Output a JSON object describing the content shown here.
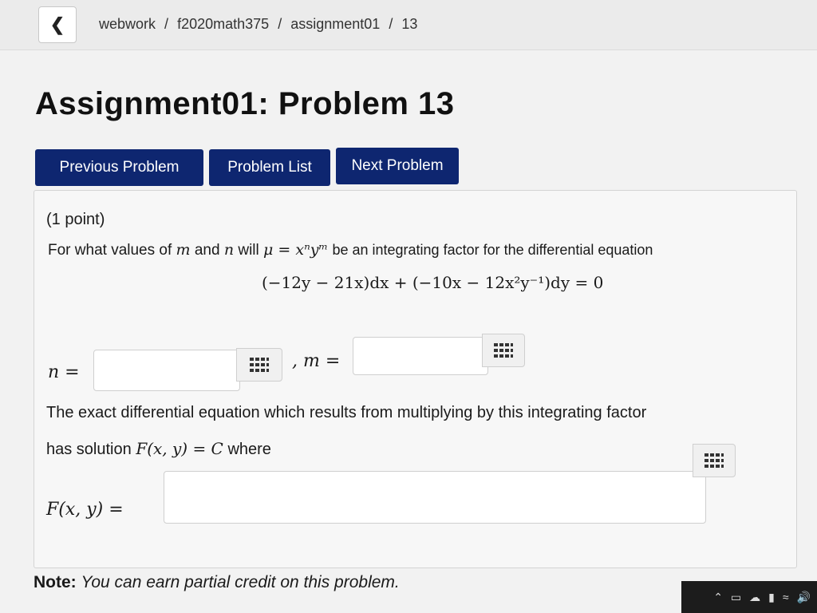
{
  "breadcrumb": [
    "webwork",
    "/",
    "f2020math375",
    "/",
    "assignment01",
    "/",
    "13"
  ],
  "back_icon": "chevron-left-icon",
  "title": "Assignment01: Problem 13",
  "nav": {
    "previous": "Previous Problem",
    "list": "Problem List",
    "next": "Next Problem"
  },
  "problem": {
    "points": "(1 point)",
    "question_a": "For what values of",
    "var_m": "m",
    "and": "and",
    "var_n": "n",
    "will": "will",
    "mu_expr": "μ = xⁿyᵐ",
    "question_b": "be an integrating factor for the differential equation",
    "equation": "(−12y − 21x)dx + (−10x − 12x²y⁻¹)dy = 0",
    "n_label": "n =",
    "m_label": ", m =",
    "n_value": "",
    "m_value": "",
    "exact_line1": "The exact differential equation which results from multiplying by this integrating factor",
    "exact_line2_a": "has solution",
    "exact_line2_expr": "F(x, y) = C",
    "exact_line2_b": "where",
    "f_label": "F(x, y)  =",
    "f_value": ""
  },
  "note": {
    "label": "Note:",
    "text": "You can earn partial credit on this problem."
  },
  "accent_color": "#0e2670"
}
